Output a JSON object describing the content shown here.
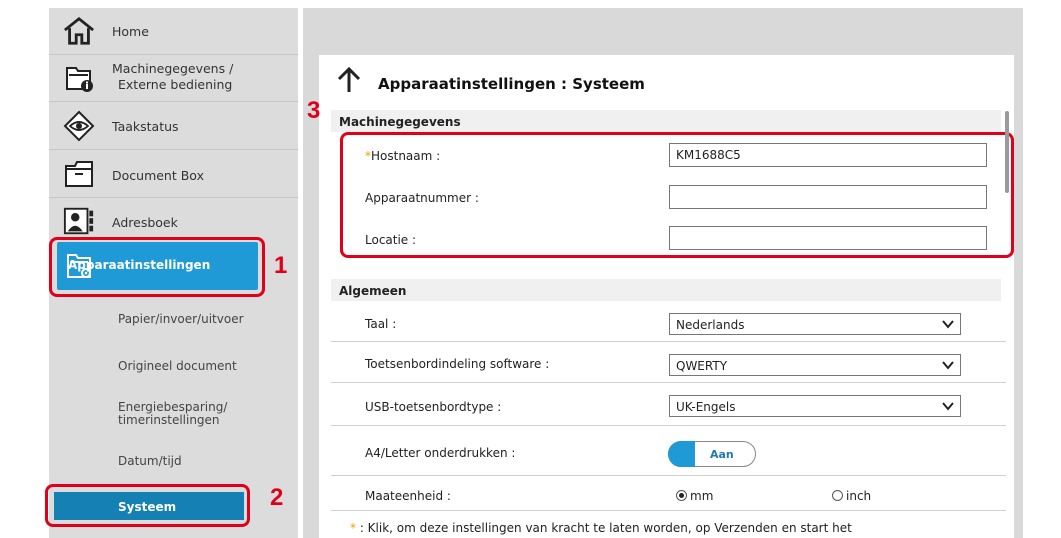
{
  "sidebar": {
    "home": "Home",
    "machine_info_line1": "Machinegegevens /",
    "machine_info_line2": "Externe bediening",
    "job_status": "Taakstatus",
    "document_box": "Document Box",
    "address_book": "Adresboek",
    "device_settings": "Apparaatinstellingen",
    "sub_items": {
      "paper": "Papier/invoer/uitvoer",
      "original": "Origineel document",
      "energy_line1": "Energiebesparing/",
      "energy_line2": "timerinstellingen",
      "datetime": "Datum/tijd",
      "system": "Systeem"
    }
  },
  "callouts": {
    "one": "1",
    "two": "2",
    "three": "3"
  },
  "page": {
    "title": "Apparaatinstellingen : Systeem",
    "machine_section": {
      "header": "Machinegegevens",
      "hostname_required_mark": "*",
      "hostname_label": "Hostnaam :",
      "hostname_value": "KM1688C5",
      "device_number_label": "Apparaatnummer :",
      "device_number_value": "",
      "location_label": "Locatie :",
      "location_value": ""
    },
    "general_section": {
      "header": "Algemeen",
      "language_label": "Taal :",
      "language_value": "Nederlands",
      "keyboard_layout_label": "Toetsenbordindeling software :",
      "keyboard_layout_value": "QWERTY",
      "usb_keyboard_label": "USB-toetsenbordtype :",
      "usb_keyboard_value": "UK-Engels",
      "a4_letter_label": "A4/Letter onderdrukken :",
      "a4_letter_toggle": "Aan",
      "units_label": "Maateenheid :",
      "unit_mm": "mm",
      "unit_inch": "inch",
      "selected_unit": "mm"
    },
    "footnote_mark": "*",
    "footnote": ": Klik, om deze instellingen van kracht te laten worden, op Verzenden en start het"
  },
  "colors": {
    "accent": "#1f9ad6",
    "callout_red": "#e1001a",
    "system_active": "#1480b3"
  }
}
